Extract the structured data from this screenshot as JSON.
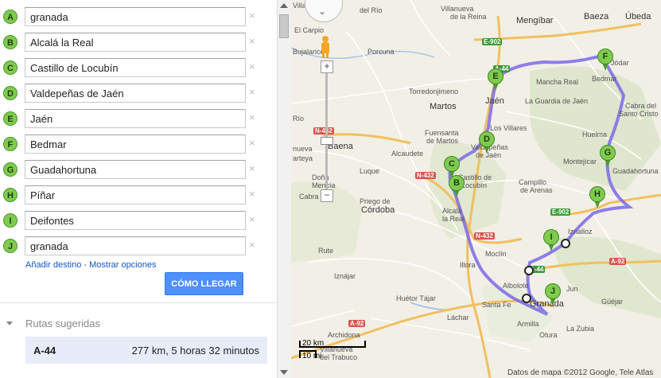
{
  "waypoints": [
    {
      "letter": "A",
      "value": "granada"
    },
    {
      "letter": "B",
      "value": "Alcalá la Real"
    },
    {
      "letter": "C",
      "value": "Castillo de Locubín"
    },
    {
      "letter": "D",
      "value": "Valdepeñas de Jaén"
    },
    {
      "letter": "E",
      "value": "Jaén"
    },
    {
      "letter": "F",
      "value": "Bedmar"
    },
    {
      "letter": "G",
      "value": "Guadahortuna"
    },
    {
      "letter": "H",
      "value": "Píñar"
    },
    {
      "letter": "I",
      "value": "Deifontes"
    },
    {
      "letter": "J",
      "value": "granada"
    }
  ],
  "remove_glyph": "×",
  "links": {
    "add_destination": "Añadir destino",
    "separator": " - ",
    "show_options": "Mostrar opciones"
  },
  "go_button": "CÓMO LLEGAR",
  "suggested": {
    "title": "Rutas sugeridas",
    "route": {
      "name": "A-44",
      "info": "277 km, 5 horas 32 minutos"
    }
  },
  "map": {
    "pins": [
      "B",
      "C",
      "D",
      "E",
      "F",
      "G",
      "H",
      "I",
      "J"
    ],
    "labels": {
      "villar": "Villar",
      "rio": "del Río",
      "villanueva": "Villanueva",
      "reina": "de la Reina",
      "mengibar": "Mengíbar",
      "baeza": "Baeza",
      "ubeda": "Úbeda",
      "carpio": "El Carpio",
      "bujalance": "Bujalance",
      "porcuna": "Porcuna",
      "torredonjimeno": "Torredonjimeno",
      "mancha_real": "Mancha Real",
      "jodar": "Jódar",
      "bedmar": "Bedmar",
      "martos": "Martos",
      "jaen": "Jaén",
      "guardia": "La Guardia de Jaén",
      "rio_w": "Río",
      "villares": "Los Villares",
      "fuensanta": "Fuensanta",
      "de_martos": "de Martos",
      "cabra_santo": "Cabra del",
      "cabra_santo2": "Santo Cristo",
      "valdepenas": "Valdepeñas",
      "de_jaen": "de Jaén",
      "nueva": "nueva",
      "arteya": "arteya",
      "baena": "Baena",
      "alcaudete": "Alcaudete",
      "huelma": "Huelma",
      "montejicar": "Montejícar",
      "castillo": "Castillo de",
      "locubin": "Locubín",
      "campillo": "Campillo",
      "arenas": "de Arenas",
      "guadahortuna": "Guadahortuna",
      "luque": "Luque",
      "dona": "Doña",
      "mencia": "Mencía",
      "cabra": "Cabra",
      "priego": "Priego de",
      "cordoba": "Córdoba",
      "iznalloz": "Iznalloz",
      "alcala": "Alcalá",
      "la_real": "la Real",
      "rute": "Rute",
      "moclin": "Moclín",
      "illora": "Illora",
      "iznajar": "Iznájar",
      "albolote": "Albolote",
      "jun": "Jun",
      "granada": "Granada",
      "huetor": "Huétor Tájar",
      "santa_fe": "Santa Fe",
      "guejar": "Güéjar",
      "lachar": "Láchar",
      "archidona": "Archidona",
      "armilla": "Armilla",
      "la_zubia": "La Zubia",
      "otura": "Otura",
      "villanueva_t": "Villanueva",
      "del_trabuco": "del Trabuco"
    },
    "roads": {
      "e902": "E-902",
      "a44": "A-44",
      "n432a": "N-432",
      "n432b": "N-432",
      "n432c": "N-432",
      "a92a": "A-92",
      "a92b": "A-92"
    },
    "scale": {
      "top": "20 km",
      "bottom": "10 mi"
    },
    "attribution": "Datos de mapa ©2012 Google, Tele Atlas",
    "zoom": {
      "plus": "+",
      "minus": "−",
      "pan_glyph": "⌄"
    },
    "colors": {
      "route": "#7b6ae6",
      "pin": "#7fca4f",
      "button": "#4d90fe",
      "road_highway": "#f0c060"
    }
  }
}
